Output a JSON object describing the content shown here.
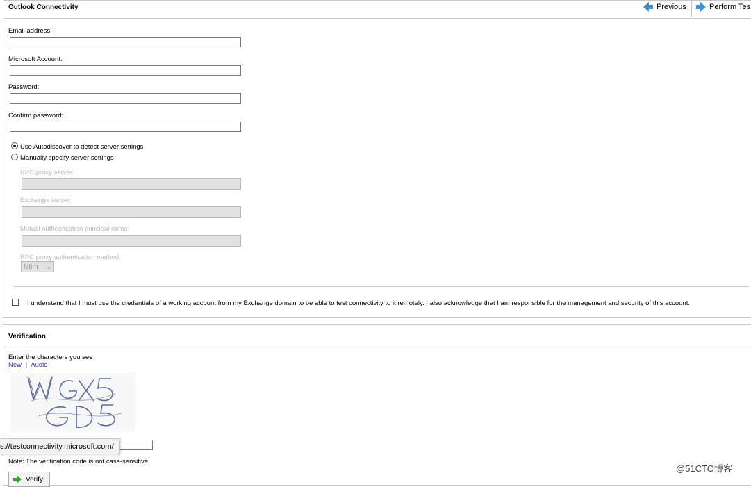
{
  "header": {
    "title": "Outlook Connectivity",
    "previous_label": "Previous",
    "perform_label": "Perform Tes"
  },
  "form": {
    "email_label": "Email address:",
    "email_value": "",
    "account_label": "Microsoft Account:",
    "account_value": "",
    "password_label": "Password:",
    "password_value": "",
    "confirm_label": "Confirm password:",
    "confirm_value": "",
    "radio_auto_label": "Use Autodiscover to detect server settings",
    "radio_manual_label": "Manually specify server settings",
    "rpc_proxy_label": "RPC proxy server:",
    "exchange_server_label": "Exchange server:",
    "mutual_auth_label": "Mutual authentication principal name:",
    "rpc_auth_method_label": "RPC proxy authentication method:",
    "rpc_auth_method_value": "Ntlm",
    "ack_text": "I understand that I must use the credentials of a working account from my Exchange domain to be able to test connectivity to it remotely. I also acknowledge that I am responsible for the management and security of this account."
  },
  "verification": {
    "title": "Verification",
    "instruction": "Enter the characters you see",
    "new_link": "New",
    "separator": "|",
    "audio_link": "Audio",
    "captcha_text": "WGX5 GD5",
    "url_tooltip": "s://testconnectivity.microsoft.com/",
    "note": "Note: The verification code is not case-sensitive.",
    "verify_label": "Verify"
  },
  "watermark": "@51CTO博客",
  "colors": {
    "accent": "#3d8fd1",
    "border": "#c8c8c8",
    "disabled_bg": "#e2e2e2",
    "link": "#4a2c8f"
  }
}
